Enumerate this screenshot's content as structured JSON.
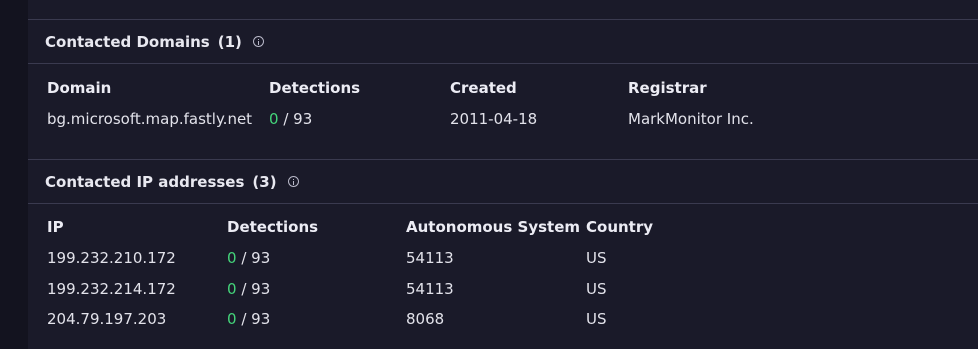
{
  "domains_section": {
    "title": "Contacted Domains",
    "count": "(1)",
    "columns": [
      "Domain",
      "Detections",
      "Created",
      "Registrar"
    ],
    "rows": [
      {
        "domain": "bg.microsoft.map.fastly.net",
        "detections_positive": "0",
        "detections_total": "/ 93",
        "created": "2011-04-18",
        "registrar": "MarkMonitor Inc."
      }
    ]
  },
  "ips_section": {
    "title": "Contacted IP addresses",
    "count": "(3)",
    "columns": [
      "IP",
      "Detections",
      "Autonomous System",
      "Country"
    ],
    "rows": [
      {
        "ip": "199.232.210.172",
        "detections_positive": "0",
        "detections_total": "/ 93",
        "as": "54113",
        "country": "US"
      },
      {
        "ip": "199.232.214.172",
        "detections_positive": "0",
        "detections_total": "/ 93",
        "as": "54113",
        "country": "US"
      },
      {
        "ip": "204.79.197.203",
        "detections_positive": "0",
        "detections_total": "/ 93",
        "as": "8068",
        "country": "US"
      }
    ]
  },
  "colors": {
    "background": "#13131f",
    "panel": "#1a1a29",
    "divider": "#3a3a4f",
    "detection_clean": "#44d47a"
  },
  "icons": [
    "info-icon"
  ]
}
